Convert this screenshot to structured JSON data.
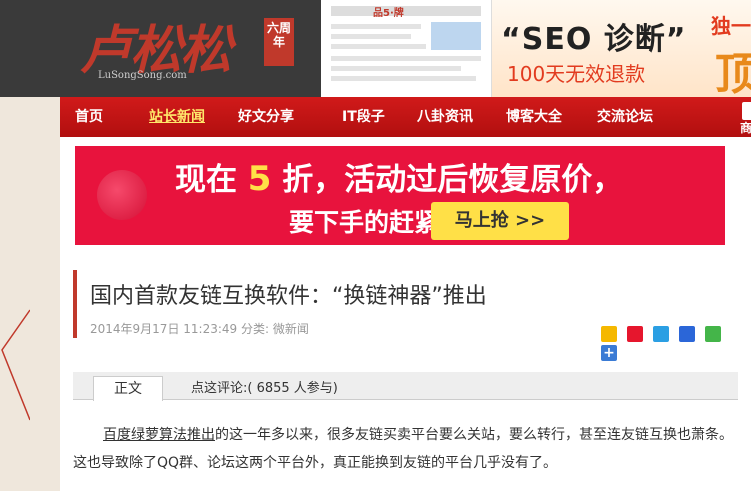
{
  "header": {
    "logo_text": "卢松松",
    "logo_domain": "LuSongSong.com",
    "logo_seal": "六周年",
    "banner": {
      "shot_logo": "品5·牌",
      "title": "“SEO 诊断”",
      "subtitle": "100天无效退款",
      "side_line1": "独一",
      "side_line2": "顶"
    }
  },
  "nav": {
    "items": [
      {
        "label": "首页"
      },
      {
        "label": "站长新闻"
      },
      {
        "label": "好文分享"
      },
      {
        "label": "IT段子"
      },
      {
        "label": "八卦资讯"
      },
      {
        "label": "博客大全"
      },
      {
        "label": "交流论坛"
      }
    ],
    "shop_label": "商"
  },
  "ad": {
    "line1_prefix": "现在",
    "line1_five": "5",
    "line1_suffix": "折，活动过后恢复原价，",
    "line2": "要下手的赶紧！",
    "button": "马上抢 >>"
  },
  "article": {
    "title": "国内首款友链互换软件：“换链神器”推出",
    "meta": "2014年9月17日 11:23:49 分类: 微新闻",
    "tab_main": "正文",
    "tab_comment": "点这评论:(    6855  人参与)",
    "body_link": "百度绿萝算法推出",
    "body_text": "的这一年多以来，很多友链买卖平台要么关站，要么转行，甚至连友链互换也萧条。 这也导致除了QQ群、论坛这两个平台外，真正能换到友链的平台几乎没有了。"
  },
  "share_icons": [
    "qzone-icon",
    "weibo-icon",
    "qq-weibo-icon",
    "baidu-icon",
    "wechat-icon",
    "more-icon"
  ],
  "colors": {
    "nav_red": "#c81414",
    "accent_red": "#c0392b",
    "ad_red": "#e8133d",
    "ad_yellow": "#ffe047",
    "header_dark": "#3a3a3a"
  }
}
